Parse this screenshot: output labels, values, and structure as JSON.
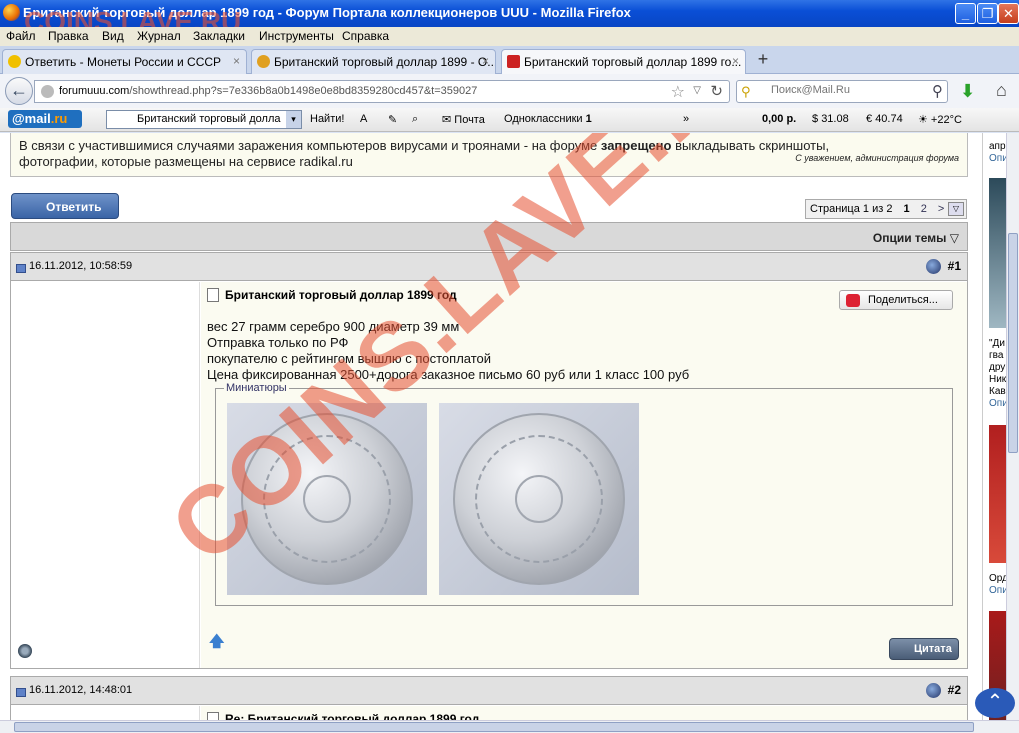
{
  "window": {
    "title": "Британский торговый доллар 1899 год - Форум Портала коллекционеров UUU - Mozilla Firefox",
    "minimize": "_",
    "maximize": "❐",
    "close": "✕"
  },
  "menu": [
    "Файл",
    "Правка",
    "Вид",
    "Журнал",
    "Закладки",
    "Инструменты",
    "Справка"
  ],
  "tabs": [
    {
      "label": "Ответить - Монеты России и СССР",
      "icon_color": "#f0c000"
    },
    {
      "label": "Британский торговый доллар 1899 - О...",
      "icon_color": "#e0a020"
    },
    {
      "label": "Британский торговый доллар 1899 го...",
      "icon_color": "#cc2222"
    }
  ],
  "tab_close": "×",
  "new_tab": "+",
  "nav": {
    "url_domain": "forumuuu.com",
    "url_path": "/showthread.php?s=7e336b8a0b1498e0e8bd8359280cd457&t=359027",
    "search_placeholder": "Поиск@Mail.Ru",
    "back_icon": "←",
    "star_icon": "☆",
    "drop_icon": "▽",
    "reload_icon": "↻",
    "search_glyph": "⚲",
    "download_icon": "⬇",
    "home_icon": "⌂"
  },
  "mailbar": {
    "logo_prefix": "@mail",
    "logo_suffix": ".ru",
    "dropdown_arrow": "▾",
    "search_value": "Британский торговый долла",
    "find": "Найти!",
    "mail": "Почта",
    "ok": "Одноклассники",
    "ok_count": "1",
    "money": "0,00 р.",
    "usd": "31.08",
    "eur": "40.74",
    "weather": "+22°C",
    "more": "»"
  },
  "notice": {
    "line1_a": "В связи с участившимися случаями заражения компьютеров вирусами и троянами - на форуме ",
    "line1_bold": "запрещено",
    "line1_b": " выкладывать скриншоты,",
    "line2": "фотографии, которые размещены на сервисе radikal.ru",
    "sign": "С уважением, администрация форума"
  },
  "reply_button": "Ответить",
  "pager": {
    "label": "Страница 1 из 2",
    "current": "1",
    "next": "2",
    "arrow": ">",
    "dropdown": "▽"
  },
  "thread_options": "Опции темы ▽",
  "posts": [
    {
      "date": "16.11.2012, 10:58:59",
      "number": "#1",
      "title": "Британский торговый доллар 1899 год",
      "share": "Поделиться...",
      "lines": [
        "вес 27 грамм серебро 900 диаметр 39 мм",
        "Отправка только по РФ",
        "покупателю с рейтингом вышлю с постоплатой",
        "Цена фиксированная 2500+дорога заказное письмо 60 руб или 1 класс 100 руб"
      ],
      "thumbs_label": "Миниатюры",
      "quote": "Цитата",
      "up_arrow": "🡅"
    },
    {
      "date": "16.11.2012, 14:48:01",
      "number": "#2",
      "title": "Re: Британский торговый доллар 1899 год"
    }
  ],
  "right_col": {
    "t1": "апр",
    "l1": "Опи",
    "t2": "\"Ди",
    "t3": "гва",
    "t4": "дру",
    "t5": "Ник",
    "t6": "Кав",
    "l2": "Опи",
    "t7": "Орд",
    "l3": "Опи"
  },
  "watermark_top": "COINS.LAVE.RU",
  "watermark": "COINS.LAVE.RU",
  "fab_icon": "⌃"
}
